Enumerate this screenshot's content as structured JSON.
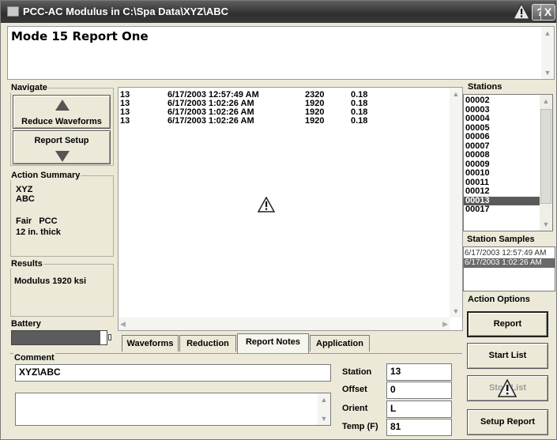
{
  "window": {
    "title": "PCC-AC Modulus in C:\\Spa Data\\XYZ\\ABC",
    "help_label": "?",
    "close_label": "X"
  },
  "header": {
    "report_title": "Mode 15 Report One"
  },
  "navigate": {
    "label": "Navigate",
    "reduce_waveforms_label": "Reduce Waveforms",
    "report_setup_label": "Report Setup"
  },
  "action_summary": {
    "label": "Action Summary",
    "line1": "XYZ",
    "line2": "ABC",
    "line3": "Fair   PCC",
    "line4": "12 in. thick"
  },
  "results": {
    "label": "Results",
    "modulus": "Modulus 1920 ksi"
  },
  "battery": {
    "label": "Battery",
    "level": 0.93
  },
  "log": {
    "rows": [
      {
        "station": "13",
        "datetime": "6/17/2003 12:57:49 AM",
        "modulus": "2320",
        "value": "0.18"
      },
      {
        "station": "13",
        "datetime": "6/17/2003 1:02:26 AM",
        "modulus": "1920",
        "value": "0.18"
      },
      {
        "station": "13",
        "datetime": "6/17/2003 1:02:26 AM",
        "modulus": "1920",
        "value": "0.18"
      },
      {
        "station": "13",
        "datetime": "6/17/2003 1:02:26 AM",
        "modulus": "1920",
        "value": "0.18"
      }
    ]
  },
  "tabs": [
    "Waveforms",
    "Reduction",
    "Report Notes",
    "Application"
  ],
  "active_tab": "Report Notes",
  "stations": {
    "label": "Stations",
    "items": [
      "00002",
      "00003",
      "00004",
      "00005",
      "00006",
      "00007",
      "00008",
      "00009",
      "00010",
      "00011",
      "00012",
      "00013",
      "00017"
    ],
    "selected": "00013"
  },
  "station_samples": {
    "label": "Station Samples",
    "items": [
      "6/17/2003 12:57:49 AM",
      "6/17/2003 1:02:26 AM"
    ],
    "selected": "6/17/2003 1:02:26 AM"
  },
  "action_options": {
    "label": "Action Options",
    "report_label": "Report",
    "start_list_label": "Start List",
    "stop_list_label": "Stop List",
    "setup_report_label": "Setup Report"
  },
  "comment": {
    "label": "Comment",
    "value": "XYZ\\ABC",
    "notes_value": ""
  },
  "fields": {
    "station_label": "Station",
    "station_value": "13",
    "offset_label": "Offset",
    "offset_value": "0",
    "orient_label": "Orient",
    "orient_value": "L",
    "temp_label": "Temp (F)",
    "temp_value": "81"
  },
  "icons": {
    "warning": "warning-triangle-icon",
    "up": "up-arrow-icon",
    "down": "down-arrow-icon"
  },
  "colors": {
    "titlebar": "#3a3a3a",
    "selection": "#5a5a5a",
    "face": "#ece9d8"
  }
}
